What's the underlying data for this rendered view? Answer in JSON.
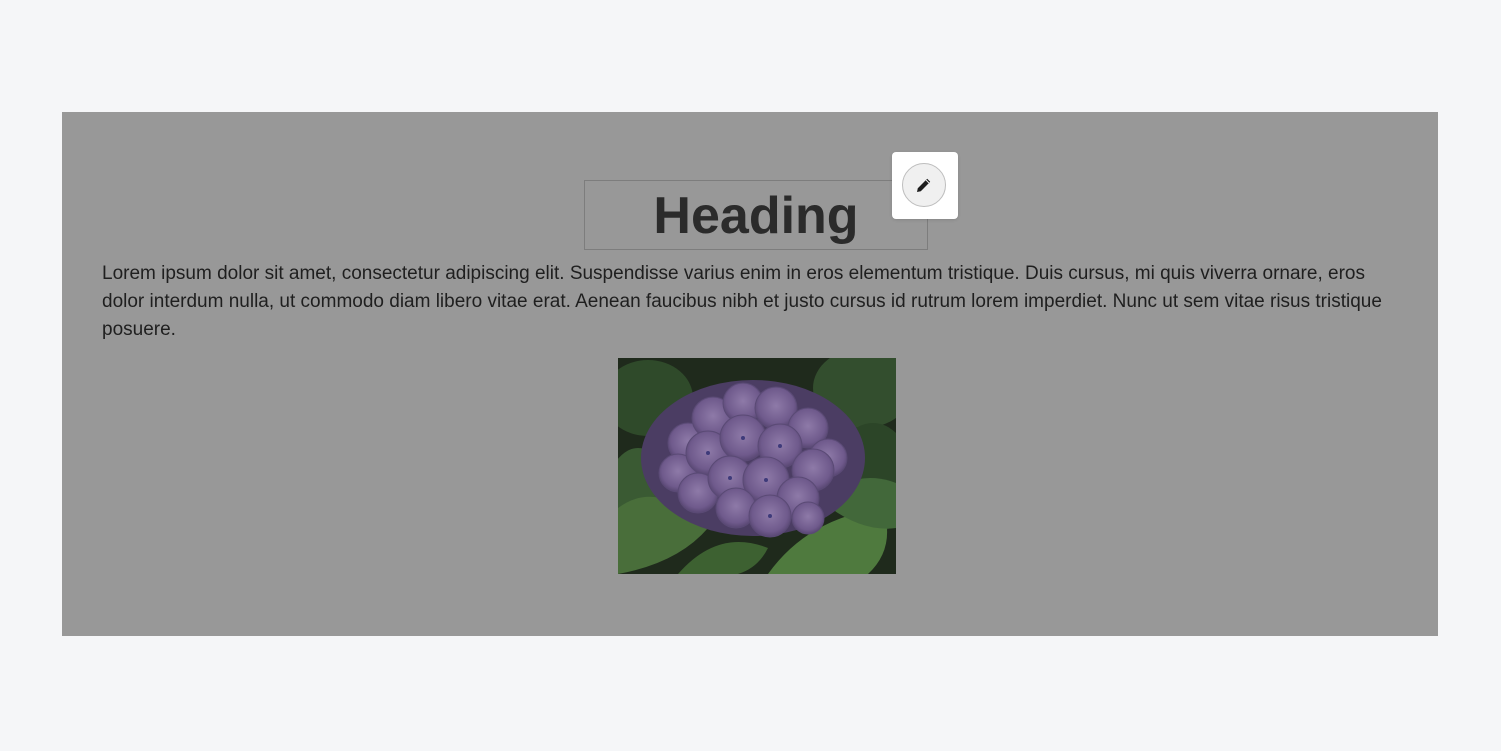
{
  "editor": {
    "heading": "Heading",
    "paragraph": "Lorem ipsum dolor sit amet, consectetur adipiscing elit. Suspendisse varius enim in eros elementum tristique. Duis cursus, mi quis viverra ornare, eros dolor interdum nulla, ut commodo diam libero vitae erat. Aenean faucibus nibh et justo cursus id rutrum lorem imperdiet. Nunc ut sem vitae risus tristique posuere.",
    "image_icon": "hydrangea-photo",
    "edit_icon": "pencil-icon"
  },
  "colors": {
    "page_background": "#f5f6f8",
    "canvas_overlay": "#989898",
    "heading_text": "#2b2b2b",
    "body_text": "#1f1f1f",
    "popover": "#ffffff"
  }
}
